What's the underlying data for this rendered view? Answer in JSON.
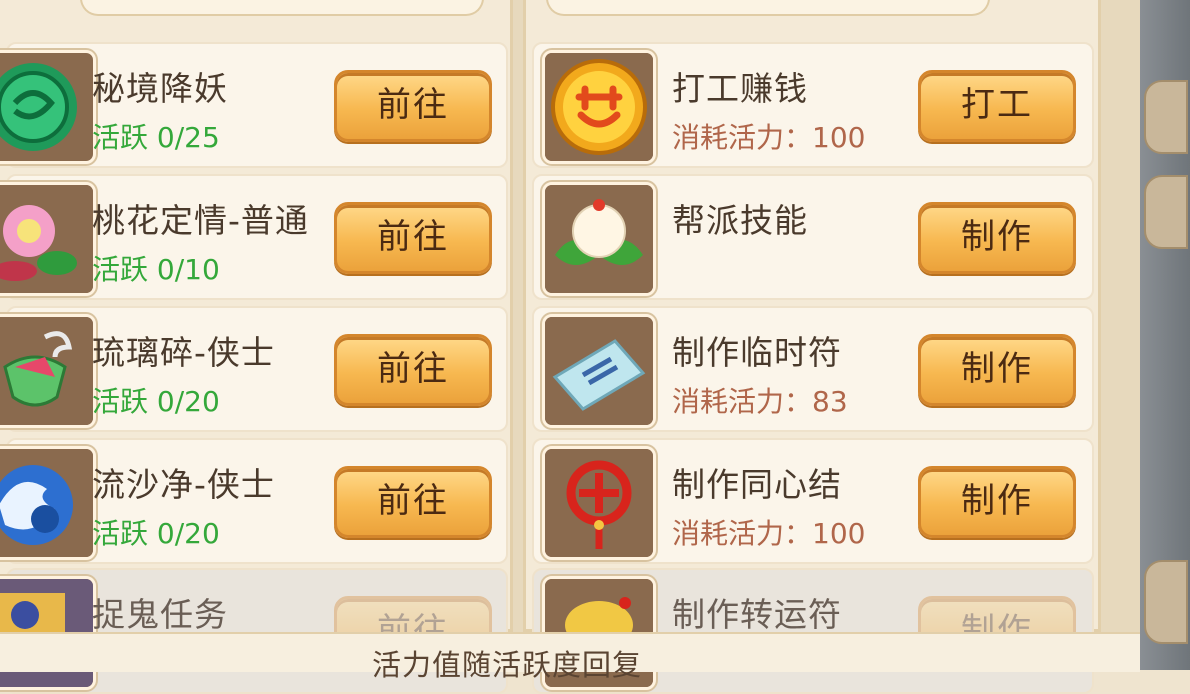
{
  "left_panel": {
    "items": [
      {
        "title": "秘境降妖",
        "sub": "活跃 0/25",
        "button": "前往",
        "icon": "jade-coin-icon"
      },
      {
        "title": "桃花定情-普通",
        "sub": "活跃 0/10",
        "button": "前往",
        "icon": "peach-blossom-icon"
      },
      {
        "title": "琉璃碎-侠士",
        "sub": "活跃 0/20",
        "button": "前往",
        "icon": "glass-vase-icon"
      },
      {
        "title": "流沙净-侠士",
        "sub": "活跃 0/20",
        "button": "前往",
        "icon": "wave-icon"
      },
      {
        "title": "捉鬼任务",
        "sub": "",
        "button": "前往",
        "icon": "ghost-task-icon"
      }
    ]
  },
  "right_panel": {
    "items": [
      {
        "title": "打工赚钱",
        "sub": "消耗活力：100",
        "button": "打工",
        "icon": "gold-dream-coin-icon"
      },
      {
        "title": "帮派技能",
        "sub": "",
        "button": "制作",
        "icon": "white-flower-icon"
      },
      {
        "title": "制作临时符",
        "sub": "消耗活力：83",
        "button": "制作",
        "icon": "talisman-paper-icon"
      },
      {
        "title": "制作同心结",
        "sub": "消耗活力：100",
        "button": "制作",
        "icon": "chinese-knot-icon"
      },
      {
        "title": "制作转运符",
        "sub": "",
        "button": "制作",
        "icon": "lucky-charm-icon"
      }
    ]
  },
  "footer": {
    "text": "活力值随活跃度回复"
  }
}
